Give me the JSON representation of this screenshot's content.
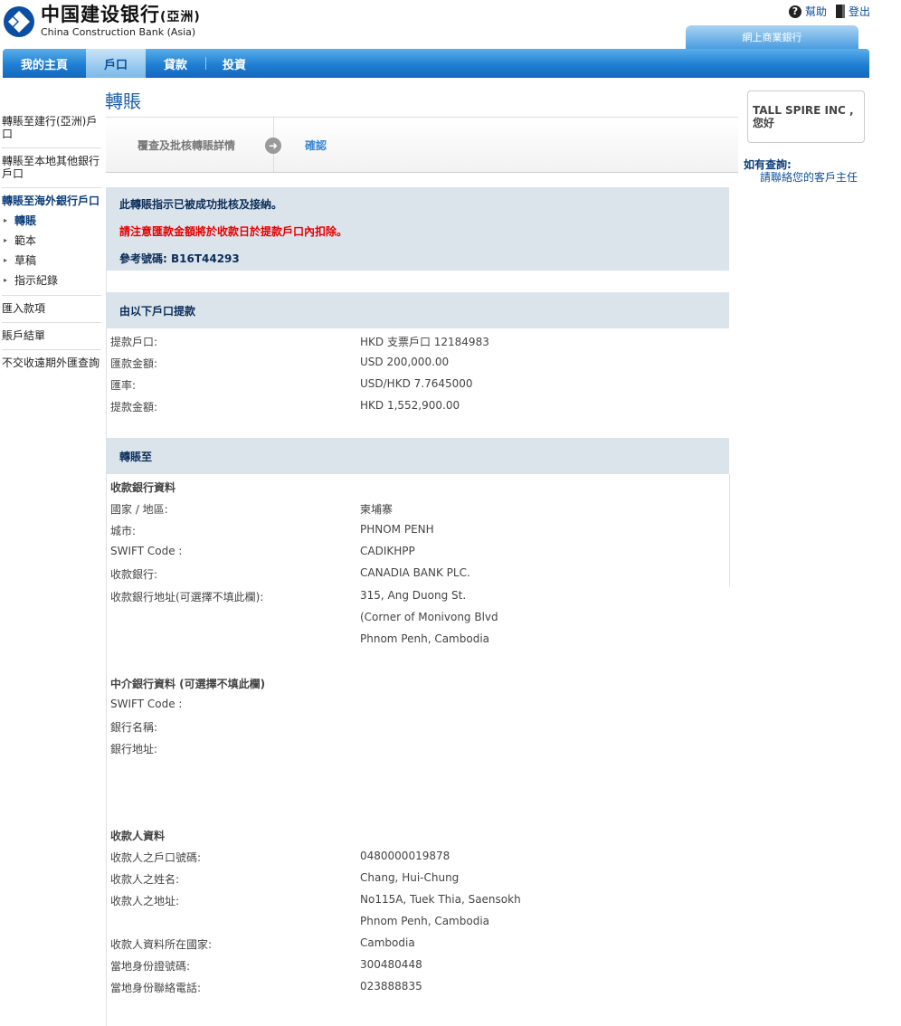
{
  "header": {
    "logo_cn": "中国建设银行",
    "logo_cn_suffix": "(亞洲)",
    "logo_en": "China Construction Bank (Asia)",
    "help": "幫助",
    "logout": "登出",
    "online_tab": "網上商業銀行",
    "icons": [
      "ccb-logo-icon",
      "help-icon",
      "logout-icon"
    ]
  },
  "nav": {
    "items": [
      "我的主頁",
      "戶口",
      "貸款",
      "投資"
    ],
    "active_index": 1
  },
  "sidebar": {
    "items": [
      "轉賬至建行(亞洲)戶口",
      "轉賬至本地其他銀行戶口",
      "轉賬至海外銀行戶口"
    ],
    "subitems": [
      "轉賬",
      "範本",
      "草稿",
      "指示紀錄"
    ],
    "bottom_items": [
      "匯入款項",
      "賬戶結單",
      "不交收遠期外匯查詢"
    ]
  },
  "user": {
    "greeting_name": "TALL SPIRE INC ,",
    "greeting": "您好"
  },
  "enquiry": {
    "title": "如有查詢:",
    "link": "請聯絡您的客戶主任"
  },
  "main": {
    "title": "轉賬",
    "steps": [
      "覆查及批核轉賬詳情",
      "確認"
    ],
    "messages": {
      "success": "此轉賬指示已被成功批核及接納。",
      "warning": "請注意匯款金額將於收款日於提款戶口內扣除。",
      "reference": "參考號碼: B16T44293"
    },
    "withdraw": {
      "header": "由以下戶口提款",
      "rows": [
        {
          "label": "提款戶口:",
          "value": "HKD 支票戶口 12184983"
        },
        {
          "label": "匯款金額:",
          "value": "USD  200,000.00"
        },
        {
          "label": "匯率:",
          "value": "USD/HKD 7.7645000"
        },
        {
          "label": "提款金額:",
          "value": "HKD 1,552,900.00"
        }
      ]
    },
    "transfer_to": {
      "header": "轉賬至",
      "bank_info_title": "收款銀行資料",
      "bank_rows": [
        {
          "label": "國家 / 地區:",
          "value": "柬埔寨"
        },
        {
          "label": "城市:",
          "value": "PHNOM PENH"
        },
        {
          "label": "SWIFT Code :",
          "value": "CADIKHPP"
        },
        {
          "label": "收款銀行:",
          "value": "CANADIA BANK PLC."
        },
        {
          "label": "收款銀行地址(可選擇不填此欄):",
          "value": "315, Ang Duong St."
        }
      ],
      "bank_address_extra": [
        "(Corner of Monivong Blvd",
        "Phnom Penh, Cambodia"
      ],
      "intermediary_title": "中介銀行資料 (可選擇不填此欄)",
      "intermediary_rows": [
        "SWIFT Code :",
        "銀行名稱:",
        "銀行地址:"
      ],
      "beneficiary_title": "收款人資料",
      "beneficiary_rows": [
        {
          "label": "收款人之戶口號碼:",
          "value": "0480000019878"
        },
        {
          "label": "收款人之姓名:",
          "value": "Chang, Hui-Chung"
        },
        {
          "label": "收款人之地址:",
          "value": "No115A, Tuek Thia, Saensokh"
        },
        {
          "label": "",
          "value": "Phnom Penh, Cambodia"
        },
        {
          "label": "收款人資料所在國家:",
          "value": "Cambodia"
        },
        {
          "label": "當地身份證號碼:",
          "value": "300480448"
        },
        {
          "label": "當地身份聯絡電話:",
          "value": "023888835"
        }
      ]
    }
  }
}
